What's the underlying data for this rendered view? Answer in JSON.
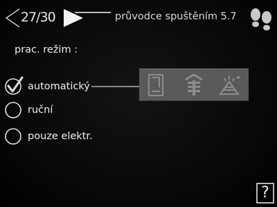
{
  "header": {
    "page_counter": "27/30",
    "title": "průvodce spuštěním  5.7"
  },
  "main": {
    "mode_label": "prac. režim :",
    "options": [
      {
        "label": "automatický",
        "selected": true
      },
      {
        "label": "ruční",
        "selected": false
      },
      {
        "label": "pouze elektr.",
        "selected": false
      }
    ],
    "auto_icons": [
      "heating-rod-icon",
      "heat-pump-icon",
      "hot-water-heating-icon"
    ]
  },
  "footer": {
    "help_glyph": "?"
  },
  "colors": {
    "background": "#070707",
    "text": "#ececec",
    "panel": "#5a5a5a",
    "panel_icon": "#8a8a8a"
  }
}
